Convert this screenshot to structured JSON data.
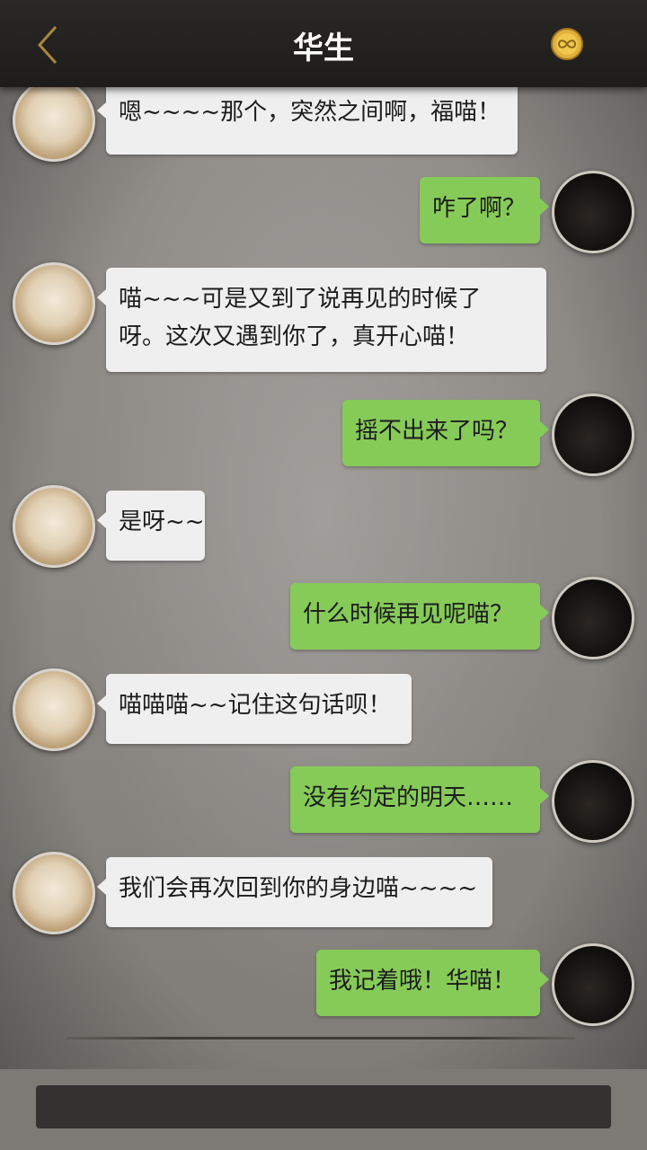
{
  "header": {
    "title": "华生",
    "back_icon": "chevron-left-icon",
    "coin_icon": "gold-coin-infinity-icon",
    "colors": {
      "bar": "#1e1c1b",
      "back": "#a9883c",
      "coin": "#e0b13b"
    }
  },
  "messages": [
    {
      "from": "cat",
      "text": "嗯~~~~那个，突然之间啊，福喵！"
    },
    {
      "from": "me",
      "text": "咋了啊？"
    },
    {
      "from": "cat",
      "lines": [
        "喵~~~可是又到了说再见的时候了",
        "呀。这次又遇到你了，真开心喵！"
      ]
    },
    {
      "from": "me",
      "text": "摇不出来了吗？"
    },
    {
      "from": "cat",
      "text": "是呀~~"
    },
    {
      "from": "me",
      "text": "什么时候再见呢喵？"
    },
    {
      "from": "cat",
      "text": "喵喵喵~~记住这句话呗！"
    },
    {
      "from": "me",
      "text": "没有约定的明天……"
    },
    {
      "from": "cat",
      "text": "我们会再次回到你的身边喵~~~~"
    },
    {
      "from": "me",
      "text": "我记着哦！华喵！"
    }
  ],
  "colors": {
    "incoming_bubble": "#efefef",
    "outgoing_bubble": "#86cb58"
  }
}
